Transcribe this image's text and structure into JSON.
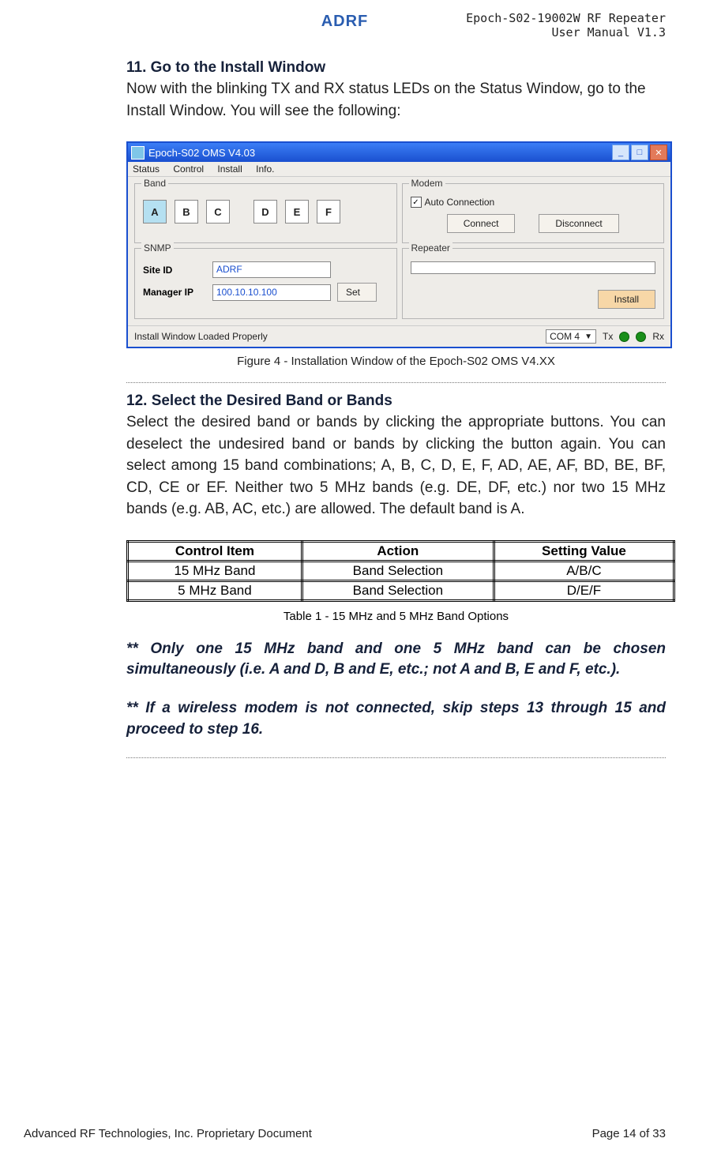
{
  "header": {
    "logo_text": "ADRF",
    "doc_line1": "Epoch-S02-19002W RF Repeater",
    "doc_line2": "User Manual V1.3"
  },
  "section11": {
    "title": "11. Go to the Install Window",
    "body": "Now with the blinking TX and RX status LEDs on the Status Window, go to the Install Window.  You will see the following:"
  },
  "winshot": {
    "title": "Epoch-S02 OMS V4.03",
    "menu": {
      "m1": "Status",
      "m2": "Control",
      "m3": "Install",
      "m4": "Info."
    },
    "band": {
      "legend": "Band",
      "b1": "A",
      "b2": "B",
      "b3": "C",
      "b4": "D",
      "b5": "E",
      "b6": "F"
    },
    "modem": {
      "legend": "Modem",
      "auto": "Auto Connection",
      "connect": "Connect",
      "disconnect": "Disconnect"
    },
    "snmp": {
      "legend": "SNMP",
      "siteid_lbl": "Site ID",
      "siteid_val": "ADRF",
      "mgrip_lbl": "Manager IP",
      "mgrip_val": "100.10.10.100",
      "set": "Set"
    },
    "repeater": {
      "legend": "Repeater",
      "install": "Install"
    },
    "status": {
      "msg": "Install Window Loaded Properly",
      "com": "COM 4",
      "tx": "Tx",
      "rx": "Rx"
    }
  },
  "fig4_caption": "Figure 4 - Installation Window of the Epoch-S02 OMS V4.XX",
  "section12": {
    "title": "12. Select the Desired Band or Bands",
    "body": "Select the desired band or bands by clicking the appropriate buttons.  You can deselect the undesired band or bands by clicking the button again.  You can select among 15 band combinations; A, B, C, D, E, F, AD, AE, AF, BD, BE, BF, CD, CE or EF.  Neither two 5 MHz bands (e.g. DE, DF, etc.) nor two 15 MHz bands (e.g. AB, AC, etc.) are allowed.  The default band is A."
  },
  "table1": {
    "h1": "Control Item",
    "h2": "Action",
    "h3": "Setting Value",
    "r1c1": "15 MHz Band",
    "r1c2": "Band Selection",
    "r1c3": "A/B/C",
    "r2c1": "5 MHz Band",
    "r2c2": "Band Selection",
    "r2c3": "D/E/F",
    "caption": "Table 1 - 15 MHz and 5 MHz Band Options"
  },
  "note1": "** Only one 15 MHz band and one 5 MHz band can be chosen simultaneously (i.e. A and D, B and E, etc.; not A and B, E and F, etc.).",
  "note2": "** If a wireless modem is not connected, skip steps 13 through 15 and proceed to step 16.",
  "footer": {
    "left": "Advanced RF Technologies, Inc. Proprietary Document",
    "right": "Page 14 of 33"
  }
}
